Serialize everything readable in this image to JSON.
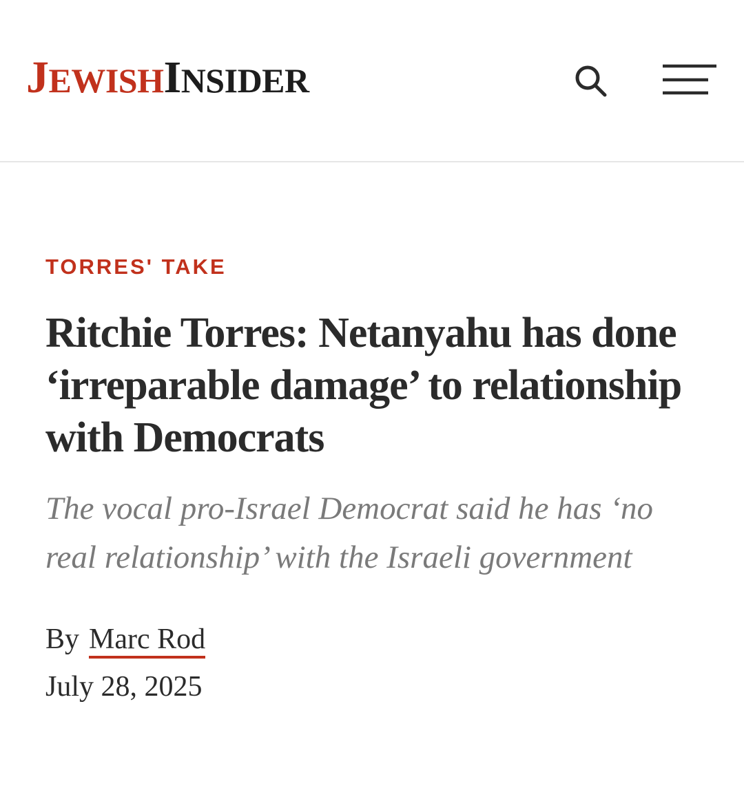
{
  "header": {
    "logo_first_initial": "J",
    "logo_first_rest": "EWISH",
    "logo_second_initial": "I",
    "logo_second_rest": "NSIDER",
    "search_icon": "search-icon",
    "menu_icon": "hamburger-menu-icon"
  },
  "article": {
    "kicker": "TORRES' TAKE",
    "headline": "Ritchie Torres: Netanyahu has done ‘irreparable damage’ to relationship with Democrats",
    "dek": "The vocal pro-Israel Democrat said he has ‘no real relationship’ with the Israeli government",
    "byline_prefix": "By",
    "author": "Marc Rod",
    "date": "July 28, 2025"
  },
  "colors": {
    "brand_red": "#c1311c",
    "text_dark": "#2b2b2b",
    "dek_gray": "#7a7a7a",
    "divider": "#e6e6e6"
  }
}
